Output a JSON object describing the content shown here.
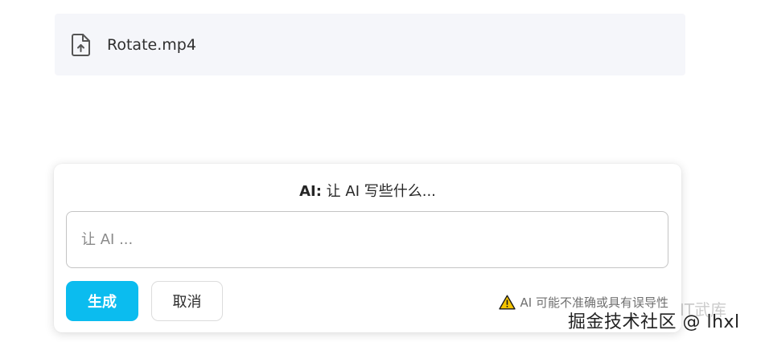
{
  "file": {
    "name": "Rotate.mp4",
    "icon": "file-upload-icon"
  },
  "ai_panel": {
    "title_prefix": "AI:",
    "title_text": "让 AI 写些什么...",
    "input": {
      "value": "",
      "placeholder": "让 AI ..."
    },
    "generate_label": "生成",
    "cancel_label": "取消",
    "disclaimer": "AI 可能不准确或具有误导性",
    "warning_icon": "warning-icon"
  },
  "watermark": {
    "faint": "IT武库",
    "text": "掘金技术社区 @ lhxl"
  },
  "colors": {
    "accent": "#0bbcef",
    "file_card_bg": "#f5f6fa",
    "warning": "#f5c400"
  }
}
